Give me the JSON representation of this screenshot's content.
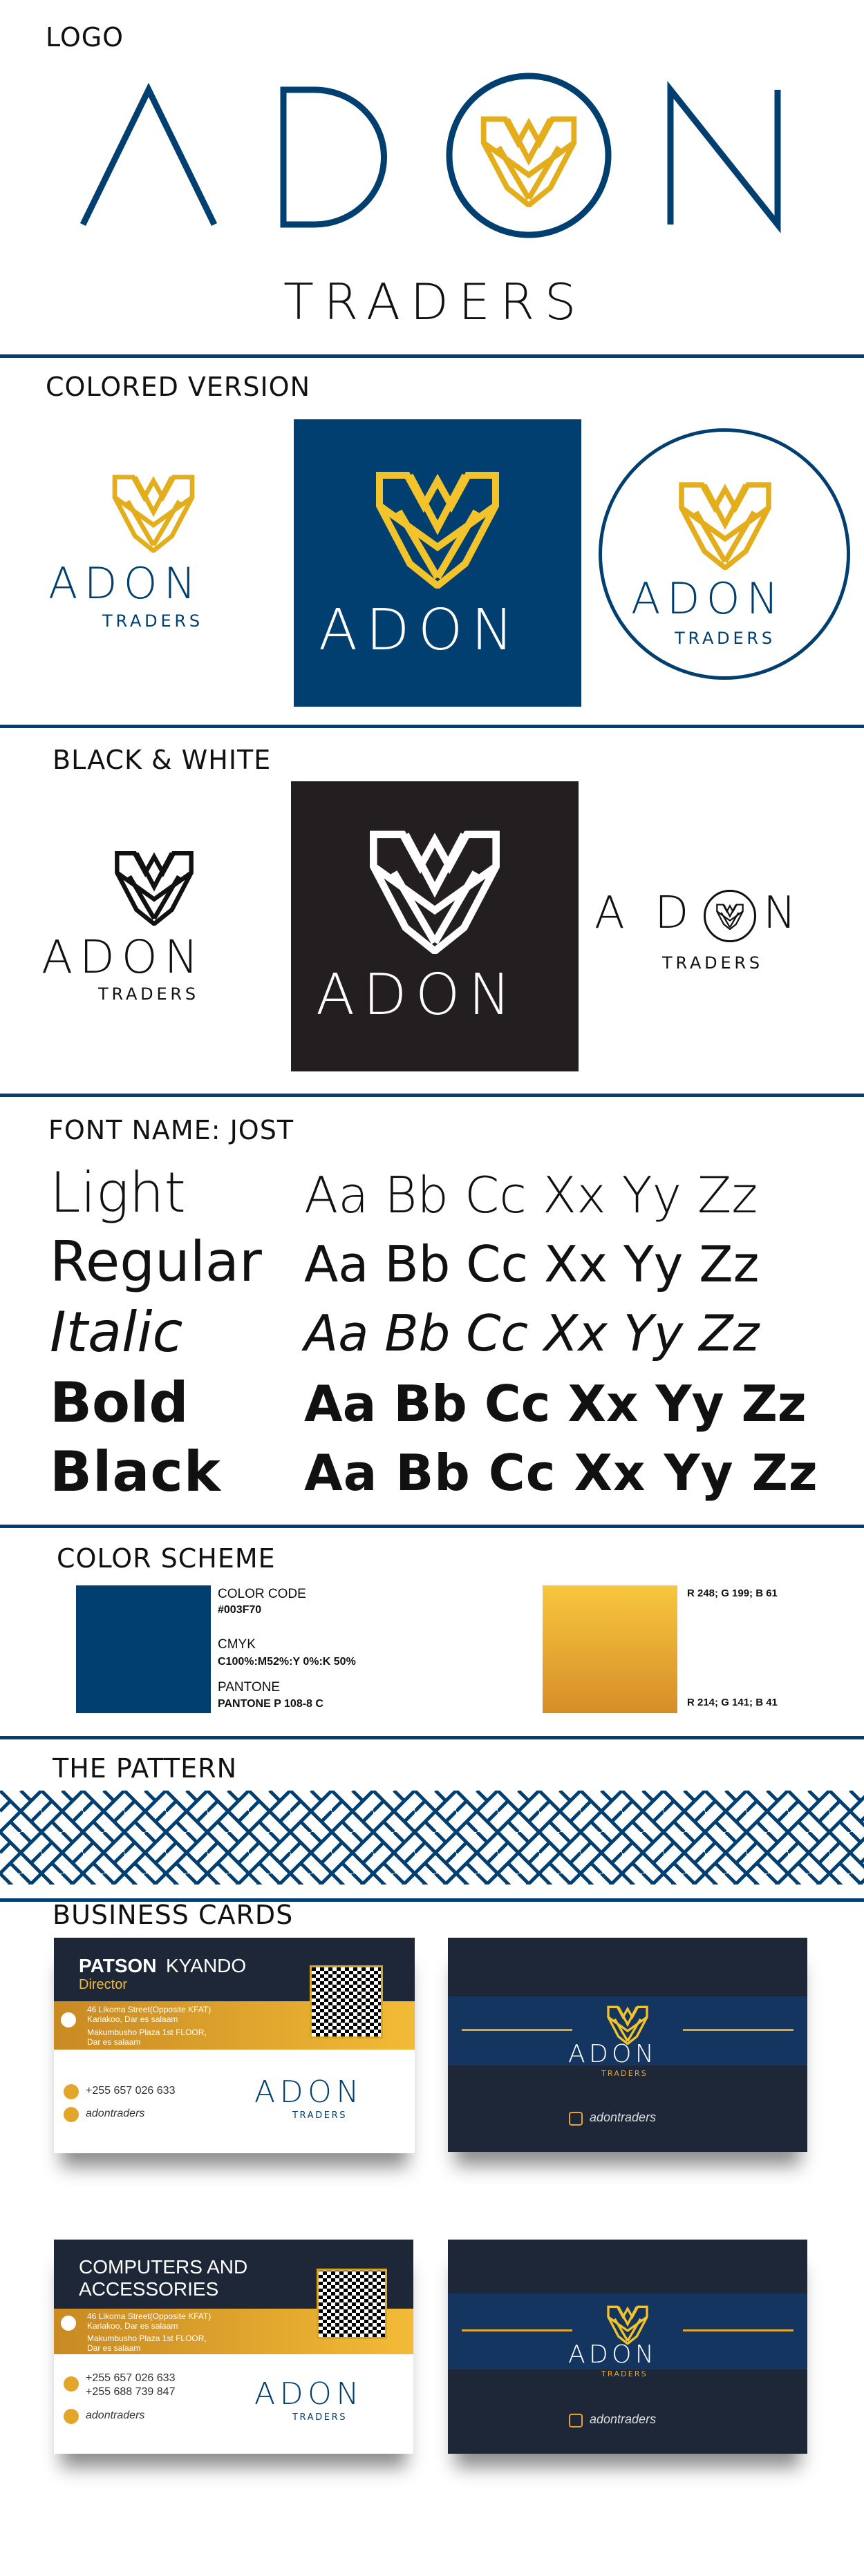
{
  "colors": {
    "navy": "#003f70",
    "gold_top": "#f8c73d",
    "gold_bottom": "#d68d29",
    "black": "#231f20",
    "dark_card": "#1e2738"
  },
  "logo_section": {
    "title": "LOGO",
    "mark": "ADON",
    "sub": "TRADERS"
  },
  "colored_section": {
    "title": "COLORED VERSION",
    "mark": "ADON",
    "sub": "TRADERS"
  },
  "bw_section": {
    "title": "BLACK & WHITE",
    "mark": "ADON",
    "sub": "TRADERS"
  },
  "font_section": {
    "title": "FONT NAME: JOST",
    "sample": "Aa Bb Cc Xx Yy Zz",
    "weights": [
      "Light",
      "Regular",
      "Italic",
      "Bold",
      "Black"
    ]
  },
  "color_scheme": {
    "title": "COLOR SCHEME",
    "code_label": "COLOR CODE",
    "code_value": "#003F70",
    "cmyk_label": "CMYK",
    "cmyk_value": "C100%:M52%:Y 0%:K 50%",
    "pantone_label": "PANTONE",
    "pantone_value": "PANTONE P 108-8 C",
    "gold_top_rgb": "R 248; G 199; B 61",
    "gold_bottom_rgb": "R 214; G 141; B 41"
  },
  "pattern_section": {
    "title": "THE PATTERN"
  },
  "cards_section": {
    "title": "BUSINESS CARDS",
    "card1": {
      "first_name": "PATSON",
      "last_name": "KYANDO",
      "role": "Director",
      "address1": "46 Likoma Street(Opposite KFAT)",
      "address2": "Kariakoo, Dar es salaam",
      "address3": "Makumbusho Plaza 1st FLOOR,",
      "address4": "Dar es salaam",
      "phone": "+255 657 026 633",
      "social": "adontraders",
      "mark": "ADON",
      "sub": "TRADERS"
    },
    "card2": {
      "headline1": "COMPUTERS AND",
      "headline2": "ACCESSORIES",
      "address1": "46 Likoma Street(Opposite KFAT)",
      "address2": "Kariakoo, Dar es salaam",
      "address3": "Makumbusho Plaza 1st FLOOR,",
      "address4": "Dar es salaam",
      "phone1": "+255 657 026 633",
      "phone2": "+255 688 739 847",
      "social": "adontraders",
      "mark": "ADON",
      "sub": "TRADERS"
    },
    "back": {
      "mark": "ADON",
      "sub": "TRADERS",
      "social": "adontraders"
    }
  }
}
